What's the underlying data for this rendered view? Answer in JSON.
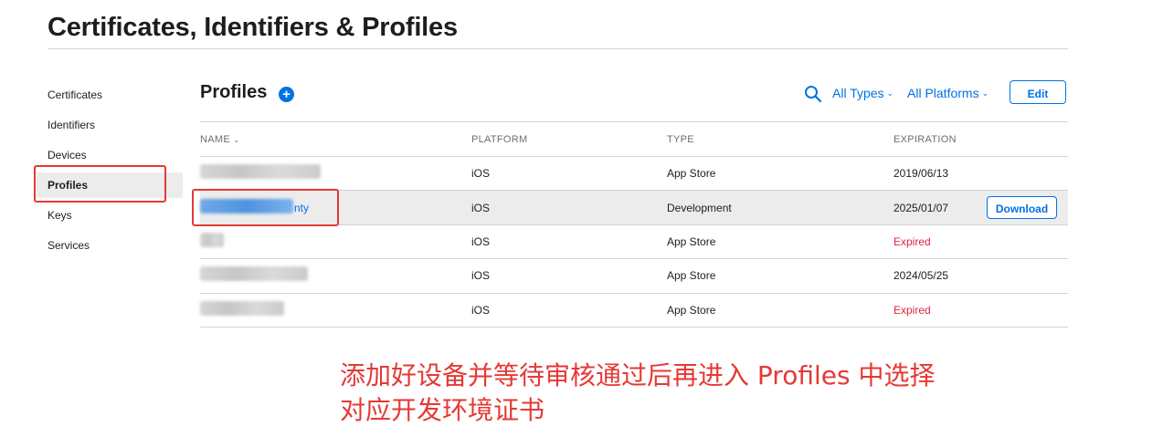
{
  "page": {
    "title": "Certificates, Identifiers & Profiles"
  },
  "sidebar": {
    "items": [
      {
        "label": "Certificates"
      },
      {
        "label": "Identifiers"
      },
      {
        "label": "Devices"
      },
      {
        "label": "Profiles",
        "active": true
      },
      {
        "label": "Keys"
      },
      {
        "label": "Services"
      }
    ]
  },
  "main": {
    "section_title": "Profiles",
    "add_icon": "plus-circle-icon",
    "search_icon": "search-icon",
    "filters": {
      "types": "All Types",
      "platforms": "All Platforms"
    },
    "edit_label": "Edit",
    "accent_color": "#0071e3",
    "expired_color": "#e0263d"
  },
  "table": {
    "headers": [
      "NAME",
      "PLATFORM",
      "TYPE",
      "EXPIRATION"
    ],
    "rows": [
      {
        "name_tail": "",
        "platform": "iOS",
        "type": "App Store",
        "expiration": "2019/06/13"
      },
      {
        "name_tail": "nty",
        "platform": "iOS",
        "type": "Development",
        "expiration": "2025/01/07",
        "selected": true,
        "action": "Download"
      },
      {
        "name_tail": "",
        "platform": "iOS",
        "type": "App Store",
        "expiration": "Expired",
        "expired": true
      },
      {
        "name_tail": "",
        "platform": "iOS",
        "type": "App Store",
        "expiration": "2024/05/25"
      },
      {
        "name_tail": "",
        "platform": "iOS",
        "type": "App Store",
        "expiration": "Expired",
        "expired": true
      }
    ]
  },
  "annotation": {
    "line1": "添加好设备并等待审核通过后再进入 Profiles 中选择",
    "line2": "对应开发环境证书",
    "color": "#e53935"
  }
}
